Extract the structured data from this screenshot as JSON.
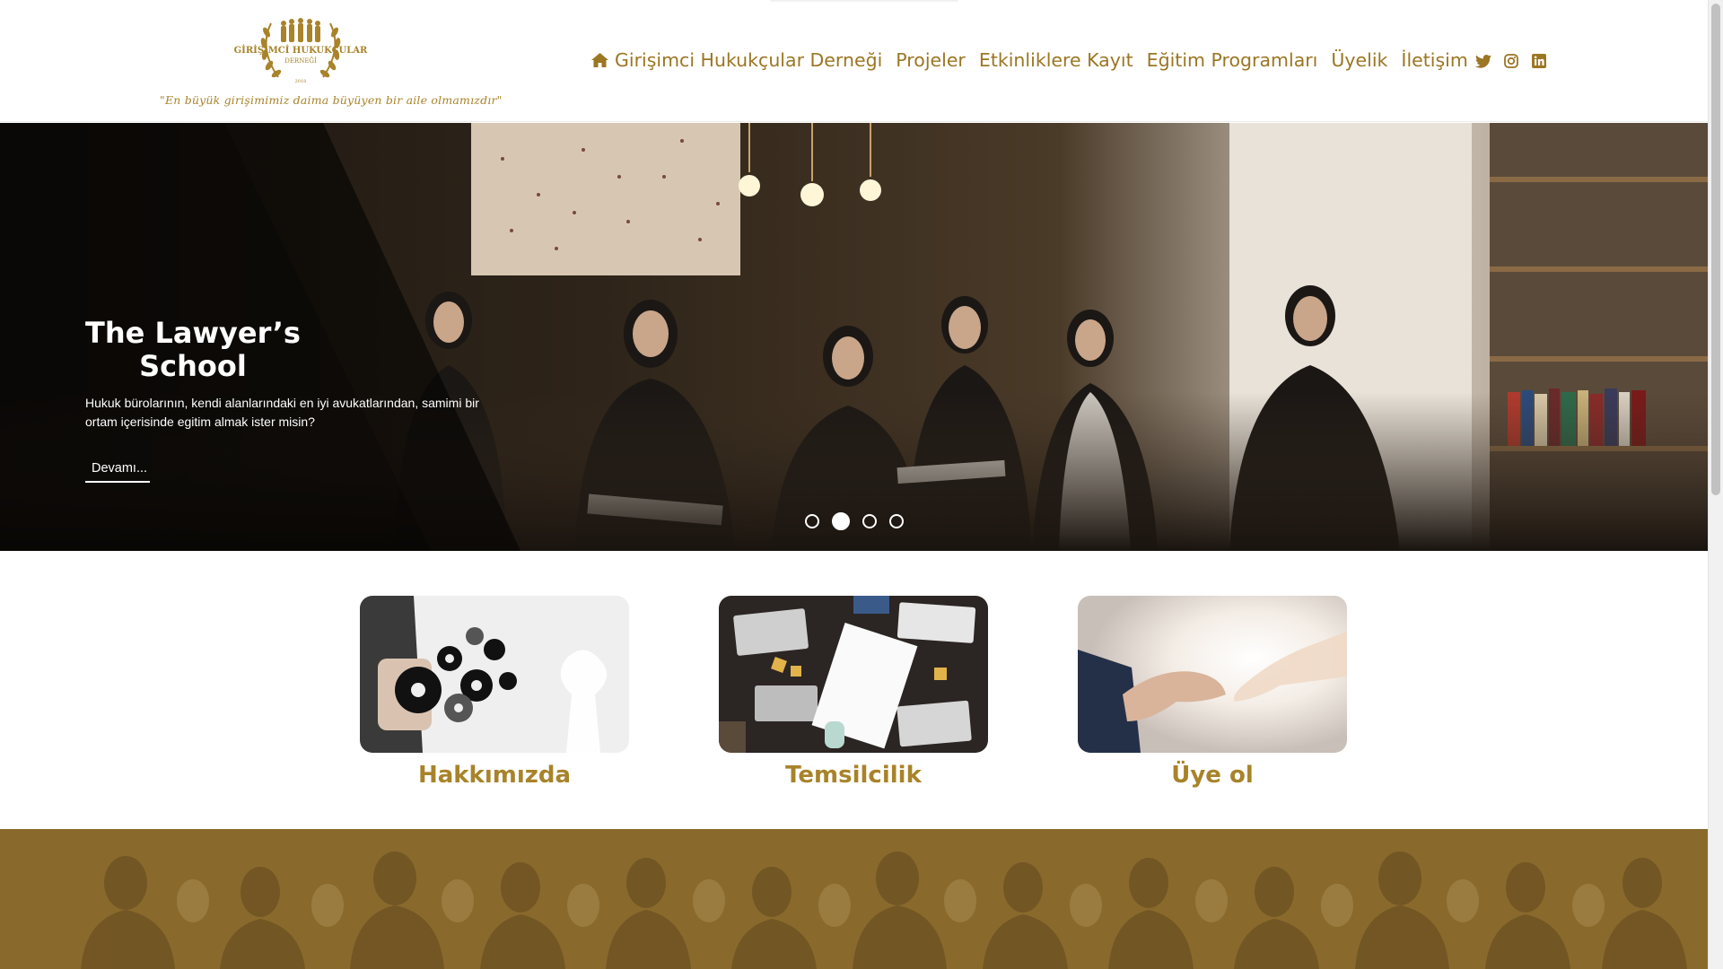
{
  "brand": {
    "logo_text": "GİRİŞİMCİ HUKUKÇULAR",
    "logo_subtext": "DERNEĞİ",
    "logo_year": "2018",
    "tagline": "\"En büyük girişimimiz daima büyüyen bir aile olmamızdır\""
  },
  "nav": {
    "home_label": "Girişimci Hukukçular Derneği",
    "items": [
      "Projeler",
      "Etkinliklere Kayıt",
      "Eğitim Programları",
      "Üyelik",
      "İletişim"
    ],
    "home_icon": "home-icon"
  },
  "social": {
    "icons": [
      "twitter-icon",
      "instagram-icon",
      "linkedin-icon"
    ]
  },
  "hero": {
    "title": "The Lawyer’s School",
    "text": "Hukuk bürolarının, kendi alanlarındaki en iyi avukatlarından, samimi bir ortam içerisinde egitim almak ister misin?",
    "cta_label": "Devamı...",
    "slide_count": 4,
    "active_slide": 2
  },
  "cards": [
    {
      "label": "Hakkımızda"
    },
    {
      "label": "Temsilcilik"
    },
    {
      "label": "Üye ol"
    }
  ],
  "colors": {
    "gold": "#a8832a",
    "nav_gold": "#9b7623",
    "banner": "#8a6a2c"
  }
}
